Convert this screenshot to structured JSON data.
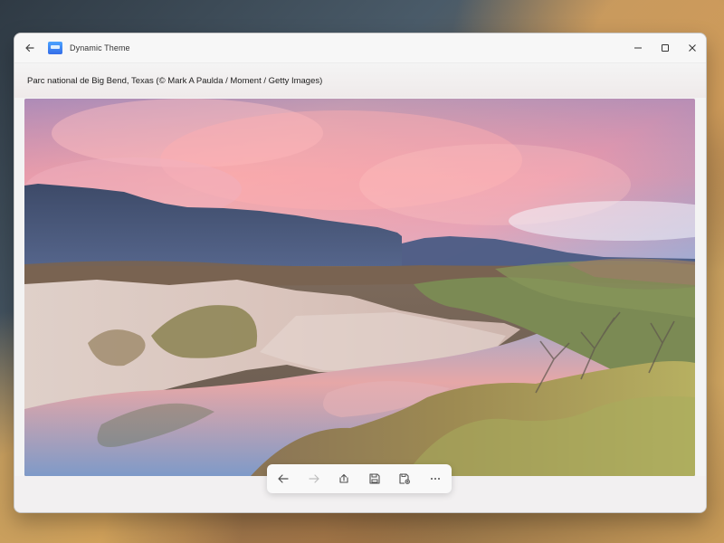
{
  "window": {
    "title": "Dynamic Theme"
  },
  "caption": {
    "text": "Parc national de Big Bend, Texas (© Mark A Paulda / Moment / Getty Images)"
  },
  "titlebar": {
    "icons": [
      "back-icon",
      "app-icon",
      "minimize-icon",
      "maximize-icon",
      "close-icon"
    ]
  },
  "toolbar": {
    "items": [
      {
        "name": "back-button",
        "icon": "arrow-left-icon"
      },
      {
        "name": "forward-button",
        "icon": "arrow-right-icon",
        "disabled": true
      },
      {
        "name": "share-button",
        "icon": "share-icon"
      },
      {
        "name": "save-button",
        "icon": "save-icon"
      },
      {
        "name": "save-as-button",
        "icon": "save-as-icon"
      },
      {
        "name": "more-options-button",
        "icon": "more-icon"
      }
    ]
  },
  "colors": {
    "window_bg": "#f3f3f3",
    "sky_pink": "#f3a6a8",
    "sky_blue": "#3f74b8",
    "mountain": "#465575",
    "water": "#8fa0c1"
  }
}
